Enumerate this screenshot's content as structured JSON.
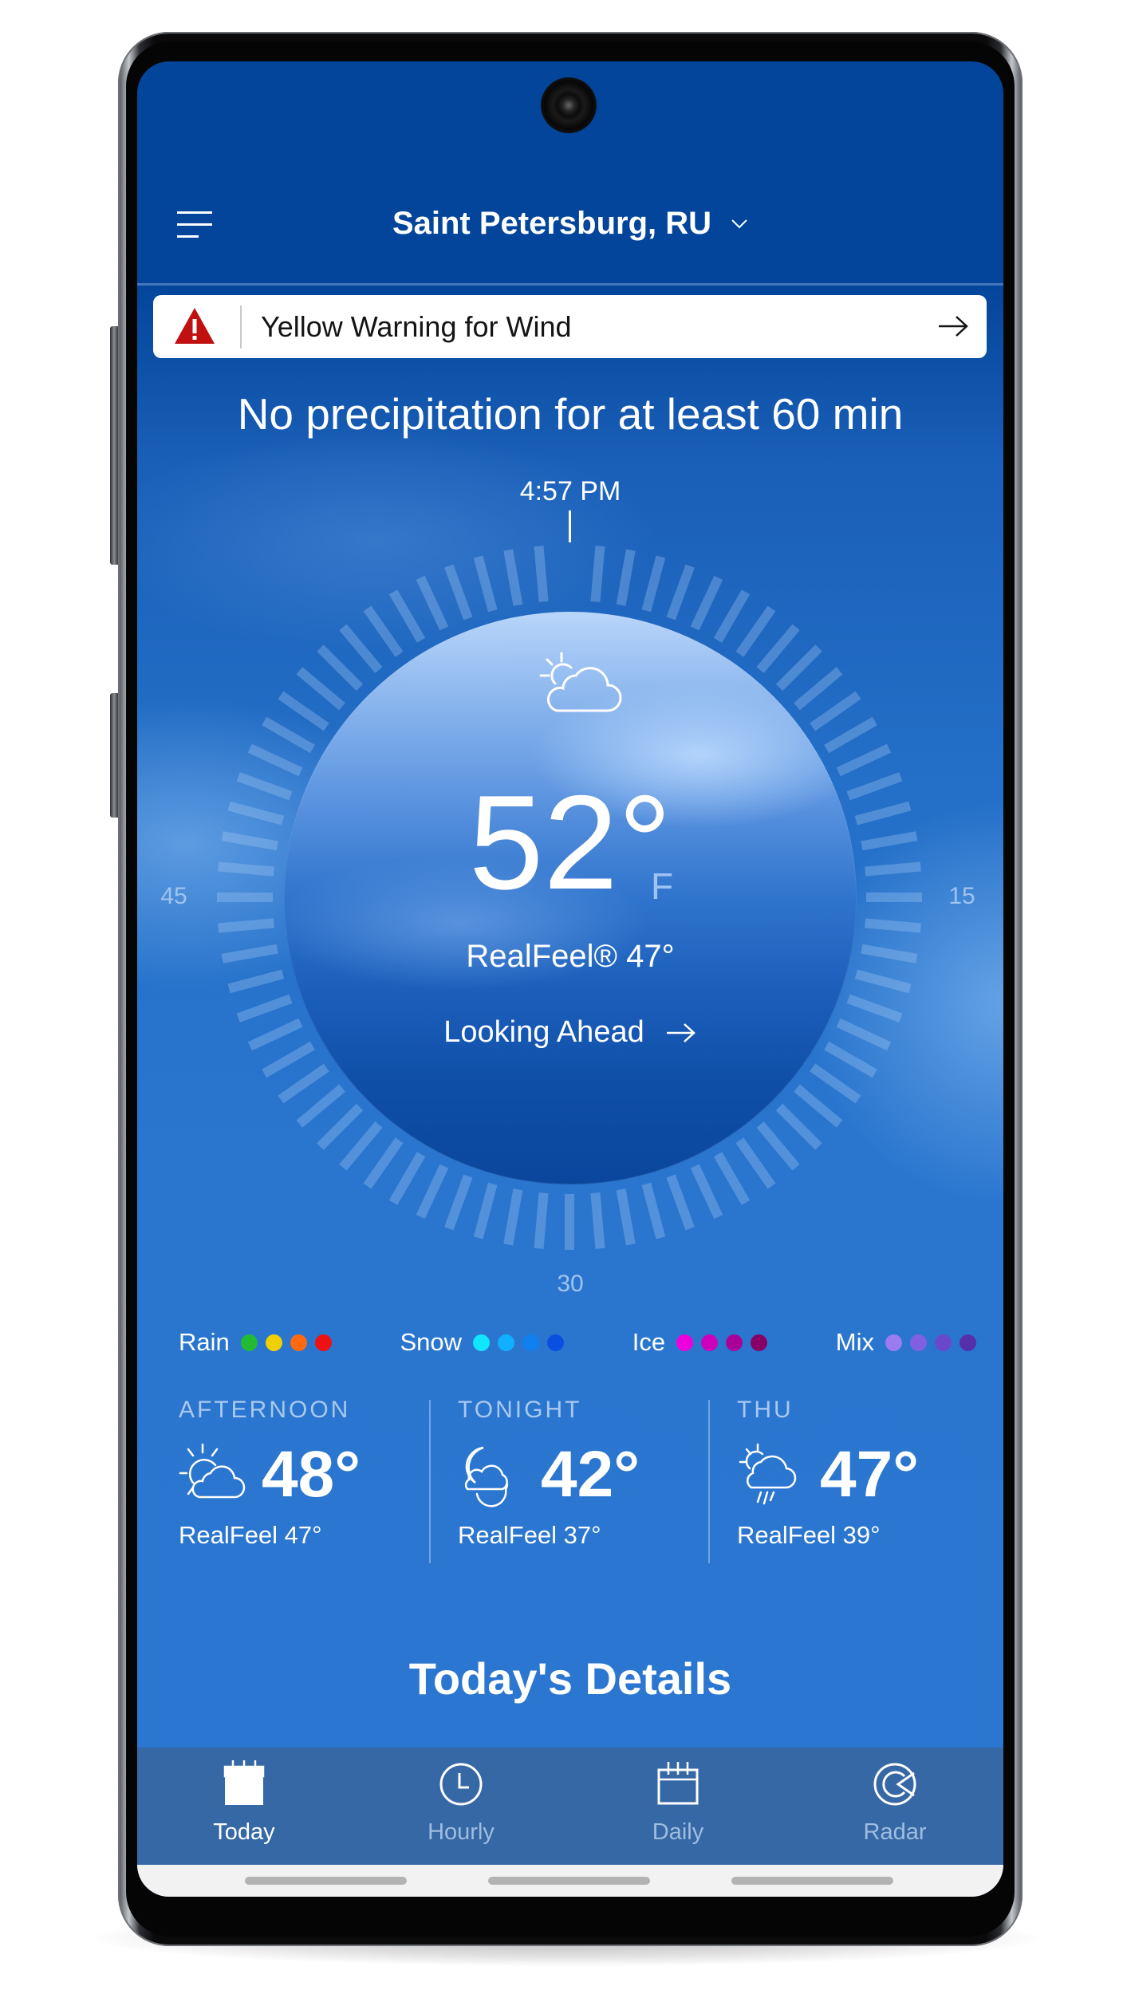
{
  "header": {
    "location": "Saint Petersburg, RU",
    "menu_icon": "hamburger-menu-icon",
    "dropdown_icon": "chevron-down-icon"
  },
  "alert": {
    "icon": "warning-triangle-icon",
    "text": "Yellow Warning for Wind",
    "action_icon": "arrow-right-icon",
    "color": "#c0100f"
  },
  "minutecast": {
    "headline": "No precipitation for at least 60 min",
    "time": "4:57 PM",
    "dial_labels": {
      "right": "15",
      "bottom": "30",
      "left": "45"
    },
    "precipitation_minutes": 0,
    "dial_minutes_total": 60
  },
  "current": {
    "icon": "partly-sunny-cloud-icon",
    "temperature": "52°",
    "unit": "F",
    "realfeel": "RealFeel® 47°",
    "looking_ahead": "Looking Ahead"
  },
  "legend": [
    {
      "label": "Rain",
      "colors": [
        "#22bb33",
        "#f0d000",
        "#ff6a10",
        "#ee1111"
      ]
    },
    {
      "label": "Snow",
      "colors": [
        "#11e6ff",
        "#11b0ff",
        "#1080f0",
        "#0a50e0"
      ]
    },
    {
      "label": "Ice",
      "colors": [
        "#ee00dd",
        "#cc00bb",
        "#aa0099",
        "#880066"
      ]
    },
    {
      "label": "Mix",
      "colors": [
        "#9b7bf0",
        "#8060e0",
        "#6a48cc",
        "#5530aa"
      ]
    }
  ],
  "forecast": [
    {
      "label": "AFTERNOON",
      "icon": "partly-sunny-icon",
      "temp": "48°",
      "realfeel": "RealFeel 47°"
    },
    {
      "label": "TONIGHT",
      "icon": "partly-cloudy-night-icon",
      "temp": "42°",
      "realfeel": "RealFeel 37°"
    },
    {
      "label": "THU",
      "icon": "sun-cloud-rain-icon",
      "temp": "47°",
      "realfeel": "RealFeel 39°"
    }
  ],
  "details_title": "Today's Details",
  "nav": {
    "items": [
      {
        "label": "Today",
        "icon": "calendar-today-icon",
        "active": true
      },
      {
        "label": "Hourly",
        "icon": "clock-icon",
        "active": false
      },
      {
        "label": "Daily",
        "icon": "calendar-icon",
        "active": false
      },
      {
        "label": "Radar",
        "icon": "radar-icon",
        "active": false
      }
    ]
  },
  "colors": {
    "header_bg": "#03459a",
    "content_bg": "#2a76cf",
    "nav_bg": "#3568a4",
    "nav_inactive": "#9fbde0",
    "dial_label": "#9fc3ef"
  }
}
